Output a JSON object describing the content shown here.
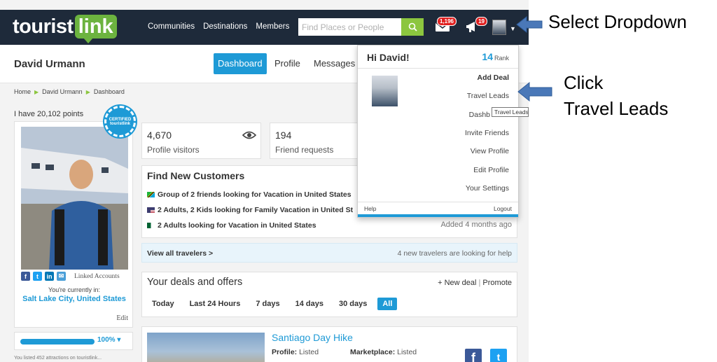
{
  "app": {
    "logo_part1": "tourist",
    "logo_part2": "link"
  },
  "nav": {
    "communities": "Communities",
    "destinations": "Destinations",
    "members": "Members"
  },
  "search": {
    "placeholder": "Find Places or People"
  },
  "notifications": {
    "mail_count": "1,196",
    "alerts_count": "19"
  },
  "header": {
    "user_name": "David Urmann",
    "tabs": [
      {
        "label": "Dashboard",
        "active": true
      },
      {
        "label": "Profile",
        "active": false
      },
      {
        "label": "Messages",
        "active": false
      }
    ]
  },
  "breadcrumb": [
    "Home",
    "David Urmann",
    "Dashboard"
  ],
  "profile": {
    "points_text": "I have 20,102 points",
    "seal_text": "CERTIFIED touristlink",
    "linked_accounts": "Linked Accounts",
    "currently_label": "You're currently in:",
    "city": "Salt Lake City, United States",
    "edit": "Edit",
    "completion": "100%",
    "completion_fraction": 1.0,
    "tiny_text": "You listed 452 attractions on touristlink..."
  },
  "stats": [
    {
      "value": "4,670",
      "label": "Profile visitors"
    },
    {
      "value": "194",
      "label": "Friend requests"
    }
  ],
  "customers": {
    "title": "Find New Customers",
    "leads": [
      {
        "text": "Group of 2 friends looking for Vacation in United States",
        "flag": "tanzania"
      },
      {
        "text": "2 Adults, 2 Kids looking for Family Vacation in United St",
        "flag": "usa"
      },
      {
        "text": "2 Adults looking for Vacation in United States",
        "flag": "algeria"
      }
    ],
    "added": "Added 4 months ago",
    "view_all": "View all travelers >",
    "new_travelers": "4 new travelers are looking for help"
  },
  "deals": {
    "title": "Your deals and offers",
    "new_deal": "+ New deal",
    "promote": "Promote",
    "filters": [
      "Today",
      "Last 24 Hours",
      "7 days",
      "14 days",
      "30 days",
      "All"
    ],
    "selected_filter": "All",
    "deal_title": "Santiago Day Hike",
    "profile_label": "Profile:",
    "profile_value": "Listed",
    "marketplace_label": "Marketplace:",
    "marketplace_value": "Listed"
  },
  "dropdown": {
    "greeting": "Hi David!",
    "rank_number": "14",
    "rank_label": "Rank",
    "items": [
      {
        "label": "Add Deal",
        "bold": true
      },
      {
        "label": "Travel Leads",
        "bold": false
      },
      {
        "label": "Dashb",
        "bold": false
      },
      {
        "label": "Invite Friends",
        "bold": false
      },
      {
        "label": "View Profile",
        "bold": false
      },
      {
        "label": "Edit Profile",
        "bold": false
      },
      {
        "label": "Your Settings",
        "bold": false
      }
    ],
    "help": "Help",
    "logout": "Logout",
    "tooltip": "Travel Leads"
  },
  "annotations": {
    "select_dropdown": "Select Dropdown",
    "click_line1": "Click",
    "click_line2": "Travel Leads"
  },
  "colors": {
    "topbar": "#1e2a3a",
    "brand_green": "#6cb33f",
    "accent_blue": "#1e9ad6",
    "badge_red": "#e02020",
    "annotation_arrow": "#4a78b8"
  }
}
